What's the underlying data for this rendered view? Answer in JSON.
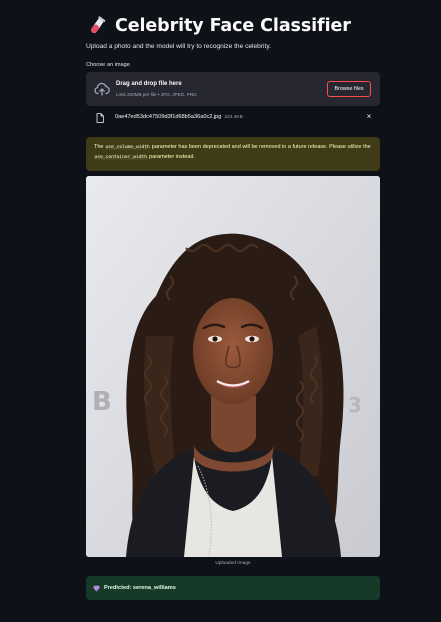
{
  "app": {
    "title": "Celebrity Face Classifier",
    "title_icon": "test-tube-icon",
    "subtitle": "Upload a photo and the model will try to recognize the celebrity."
  },
  "uploader": {
    "label": "Choose an image",
    "drop_text": "Drag and drop file here",
    "limits": "Limit 200MB per file • JPG, JPEG, PNG",
    "browse_label": "Browse files",
    "icon": "cloud-upload-icon"
  },
  "file": {
    "name": "0ae47ed53dc47509d3f1d68b5a36a0c2.jpg",
    "size": "223.4KB",
    "icon": "file-icon",
    "close": "×"
  },
  "warning": {
    "part1": "The ",
    "code1": "use_column_width",
    "part2": " parameter has been deprecated and will be removed in a future release. Please utilize the ",
    "code2": "use_container_width",
    "part3": " parameter instead."
  },
  "image": {
    "caption": "Uploaded Image"
  },
  "result": {
    "icon": "gem-icon",
    "text": "Predicted: serena_williams"
  },
  "colors": {
    "background": "#0e1117",
    "dropzone": "#262730",
    "accent": "#ff4b4b",
    "warning_bg": "#3e3b16",
    "warning_text": "#ffffc2",
    "success_bg": "#173928",
    "success_text": "#dffde9"
  }
}
